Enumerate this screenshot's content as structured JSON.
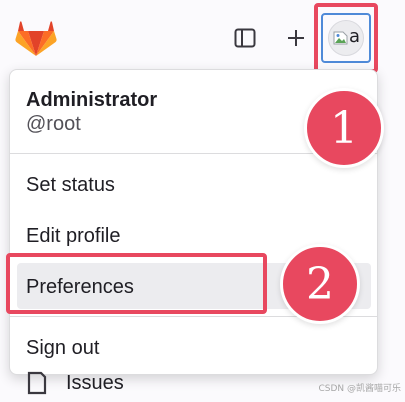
{
  "menu": {
    "user_name": "Administrator",
    "user_handle": "@root",
    "items": [
      {
        "label": "Set status"
      },
      {
        "label": "Edit profile"
      },
      {
        "label": "Preferences"
      },
      {
        "label": "Sign out"
      }
    ]
  },
  "topbar": {
    "new_label": "+",
    "avatar_alt": "a"
  },
  "sidebar": {
    "issues_label": "Issues"
  },
  "annotations": {
    "step1": "1",
    "step2": "2"
  },
  "watermark": "CSDN @凯酱喵可乐",
  "colors": {
    "annotation": "#e8485f",
    "focus": "#4f8ad8",
    "brand_orange": "#fc6d26",
    "brand_red": "#e24329",
    "brand_light": "#fca326"
  }
}
